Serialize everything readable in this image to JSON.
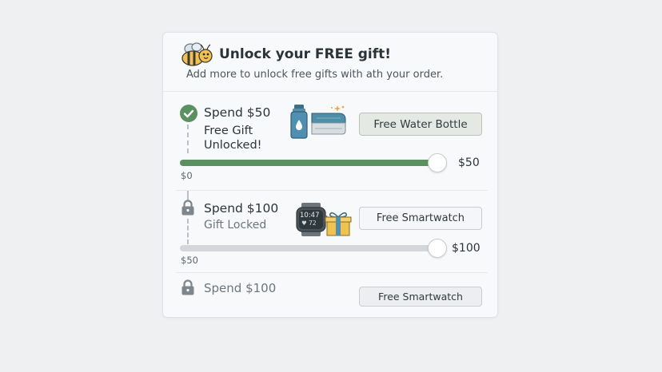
{
  "header": {
    "title": "Unlock your FREE gift!",
    "subtitle": "Add more to unlock free gifts with ath your order."
  },
  "tiers": [
    {
      "title": "Spend $50",
      "status_line1": "Free Gift",
      "status_line2": "Unlocked!",
      "button_label": "Free Water Bottle",
      "progress": {
        "start_label": "$0",
        "end_label": "$50",
        "fill_fraction": 1.0
      }
    },
    {
      "title": "Spend $100",
      "status": "Gift Locked",
      "button_label": "Free Smartwatch",
      "watch_time": "10:47",
      "watch_reading": "♥ 72",
      "progress": {
        "start_label": "$50",
        "end_label": "$100",
        "fill_fraction": 0.0
      }
    },
    {
      "title": "Spend $100",
      "button_label": "Free Smartwatch"
    }
  ],
  "colors": {
    "accent_green": "#5a9161",
    "track_gray": "#d3d7db",
    "background": "#eef0f2",
    "card": "#f8f9fa"
  },
  "icons": [
    "bee-icon",
    "check-icon",
    "water-bottle-icon",
    "towel-icon",
    "lock-icon",
    "smartwatch-icon",
    "gift-box-icon"
  ]
}
